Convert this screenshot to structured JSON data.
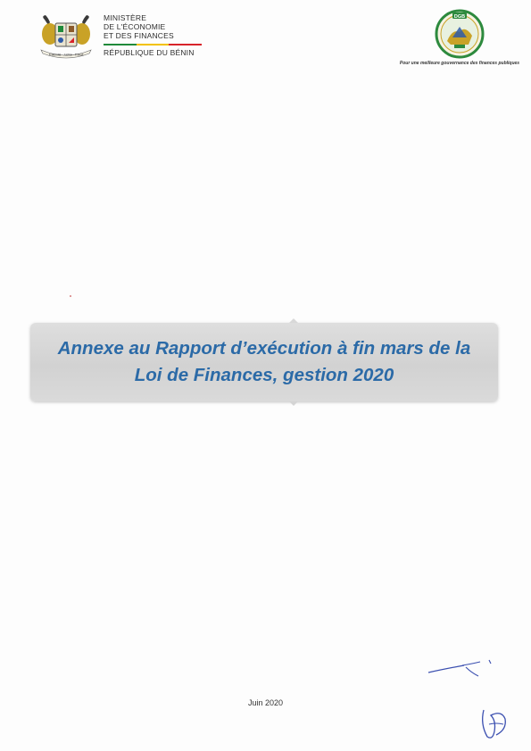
{
  "header": {
    "ministry_lines": [
      "MINISTÈRE",
      "DE L'ÉCONOMIE",
      "ET DES FINANCES"
    ],
    "republic": "RÉPUBLIQUE DU BÉNIN",
    "flag_colors": [
      "#1f8a3a",
      "#f2c200",
      "#d8232a"
    ],
    "seal_text": "DGB",
    "tagline": "Pour une meilleure gouvernance  des finances publiques"
  },
  "title": {
    "line1": "Annexe au Rapport d’exécution à fin mars de la",
    "line2": "Loi de Finances, gestion 2020",
    "color": "#2b6aa7"
  },
  "footer": {
    "date": "Juin 2020"
  }
}
